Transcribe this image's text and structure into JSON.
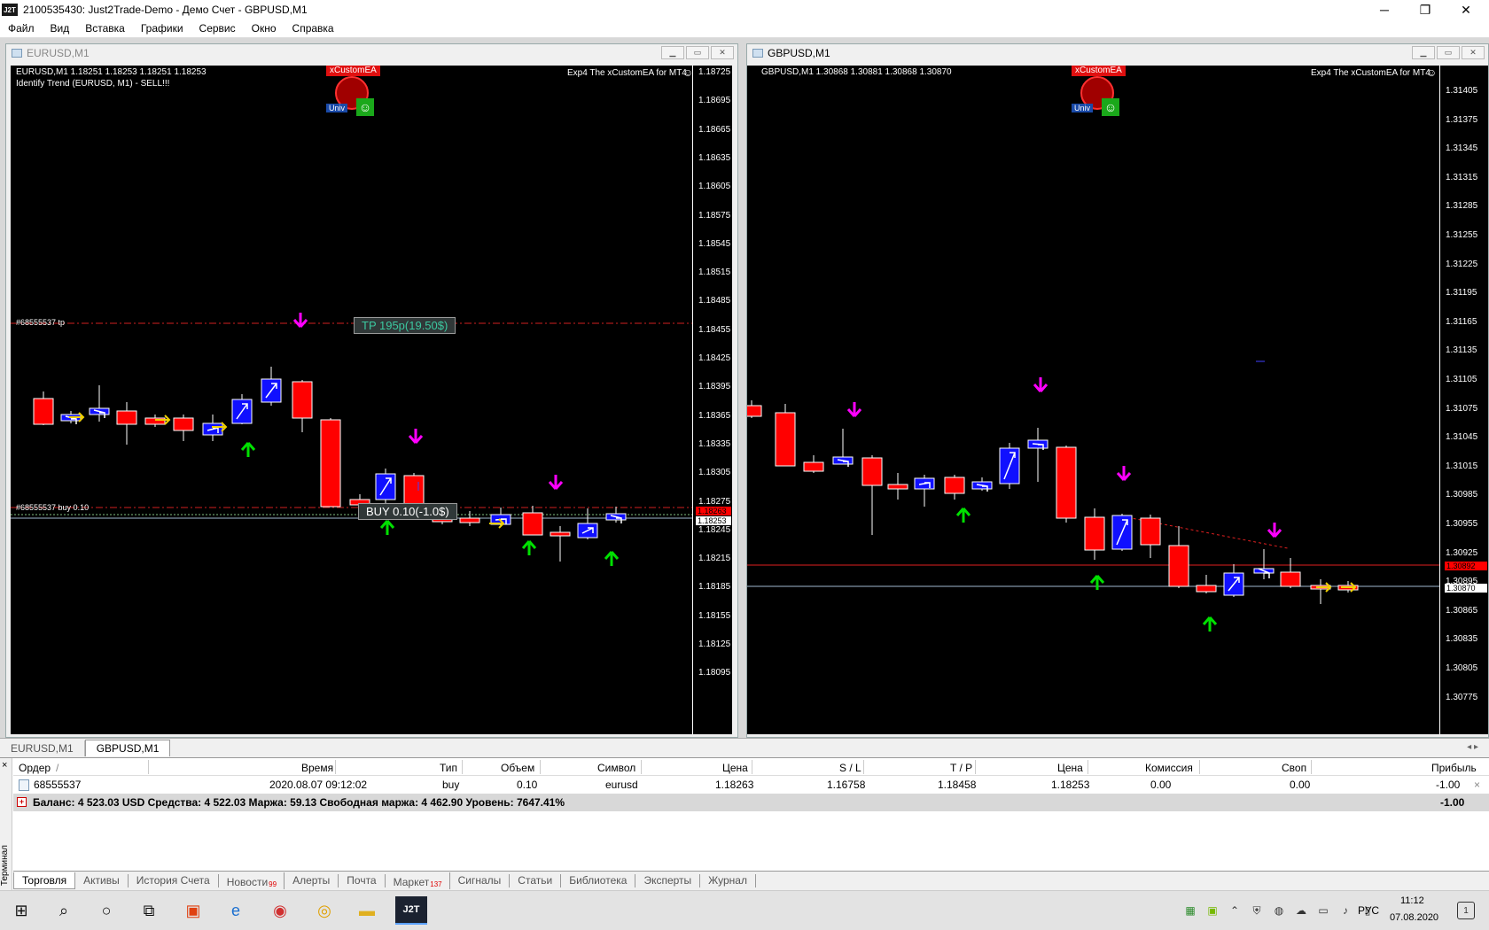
{
  "window": {
    "app_icon": "J2T",
    "title": "2100535430: Just2Trade-Demo - Демо Счет - GBPUSD,M1",
    "minimize": "─",
    "maximize": "❐",
    "close": "✕"
  },
  "menu": [
    "Файл",
    "Вид",
    "Вставка",
    "Графики",
    "Сервис",
    "Окно",
    "Справка"
  ],
  "chart_eurusd": {
    "window_title": "EURUSD,M1",
    "header": "EURUSD,M1  1.18251 1.18253 1.18251 1.18253",
    "subheader": "Identify Trend (EURUSD, M1)  -  SELL!!!",
    "ea_label": "Exp4 The xCustomEA for MT4",
    "ea_badge": "xCustomEA",
    "ea_univ": "Univ",
    "smile": "☺",
    "tp_line_label": "#68555537 tp",
    "tp_box": "TP 195p(19.50$)",
    "buy_line_label": "#68555537 buy 0.10",
    "buy_box": "BUY 0.10(-1.0$)",
    "current_price": "1.18253",
    "order_price": "1.18263",
    "ticks": [
      "1.18725",
      "1.18695",
      "1.18665",
      "1.18635",
      "1.18605",
      "1.18575",
      "1.18545",
      "1.18515",
      "1.18485",
      "1.18455",
      "1.18425",
      "1.18395",
      "1.18365",
      "1.18335",
      "1.18305",
      "1.18275",
      "1.18245",
      "1.18215",
      "1.18185",
      "1.18155",
      "1.18125",
      "1.18095"
    ]
  },
  "chart_gbpusd": {
    "window_title": "GBPUSD,M1",
    "header": "GBPUSD,M1  1.30868 1.30881 1.30868 1.30870",
    "ea_label": "Exp4 The xCustomEA for MT4",
    "ea_badge": "xCustomEA",
    "ea_univ": "Univ",
    "smile": "☺",
    "current_price": "1.30870",
    "red_price": "1.30892",
    "ticks": [
      "1.31405",
      "1.31375",
      "1.31345",
      "1.31315",
      "1.31285",
      "1.31255",
      "1.31225",
      "1.31195",
      "1.31165",
      "1.31135",
      "1.31105",
      "1.31075",
      "1.31045",
      "1.31015",
      "1.30985",
      "1.30955",
      "1.30925",
      "1.30895",
      "1.30865",
      "1.30835",
      "1.30805",
      "1.30775"
    ]
  },
  "chart_tabs": [
    "EURUSD,M1",
    "GBPUSD,M1"
  ],
  "chart_tabs_arrows": "◂ ▸",
  "terminal": {
    "close_icon": "×",
    "side_label": "Терминал",
    "columns": [
      "Ордер",
      "/",
      "Время",
      "Тип",
      "Объем",
      "Символ",
      "Цена",
      "S / L",
      "T / P",
      "Цена",
      "Комиссия",
      "Своп",
      "Прибыль"
    ],
    "order": {
      "ticket": "68555537",
      "time": "2020.08.07 09:12:02",
      "type": "buy",
      "volume": "0.10",
      "symbol": "eurusd",
      "open_price": "1.18263",
      "sl": "1.16758",
      "tp": "1.18458",
      "price": "1.18253",
      "commission": "0.00",
      "swap": "0.00",
      "profit": "-1.00",
      "close": "×"
    },
    "balance_line": "Баланс: 4 523.03 USD  Средства: 4 522.03  Маржа: 59.13  Свободная маржа: 4 462.90  Уровень: 7647.41%",
    "balance_profit": "-1.00",
    "tabs": [
      {
        "label": "Торговля",
        "badge": ""
      },
      {
        "label": "Активы",
        "badge": ""
      },
      {
        "label": "История Счета",
        "badge": ""
      },
      {
        "label": "Новости",
        "badge": "99"
      },
      {
        "label": "Алерты",
        "badge": ""
      },
      {
        "label": "Почта",
        "badge": ""
      },
      {
        "label": "Маркет",
        "badge": "137"
      },
      {
        "label": "Сигналы",
        "badge": ""
      },
      {
        "label": "Статьи",
        "badge": ""
      },
      {
        "label": "Библиотека",
        "badge": ""
      },
      {
        "label": "Эксперты",
        "badge": ""
      },
      {
        "label": "Журнал",
        "badge": ""
      }
    ]
  },
  "taskbar": {
    "j2t_label": "J2T",
    "lang": "РУС",
    "time": "11:12",
    "date": "07.08.2020",
    "notif_count": "1"
  },
  "colors": {
    "bull": "#1010ff",
    "bear": "#ff0000",
    "up_arrow": "#00e000",
    "down_arrow": "#ff00ff",
    "chart_bg": "#000000"
  }
}
